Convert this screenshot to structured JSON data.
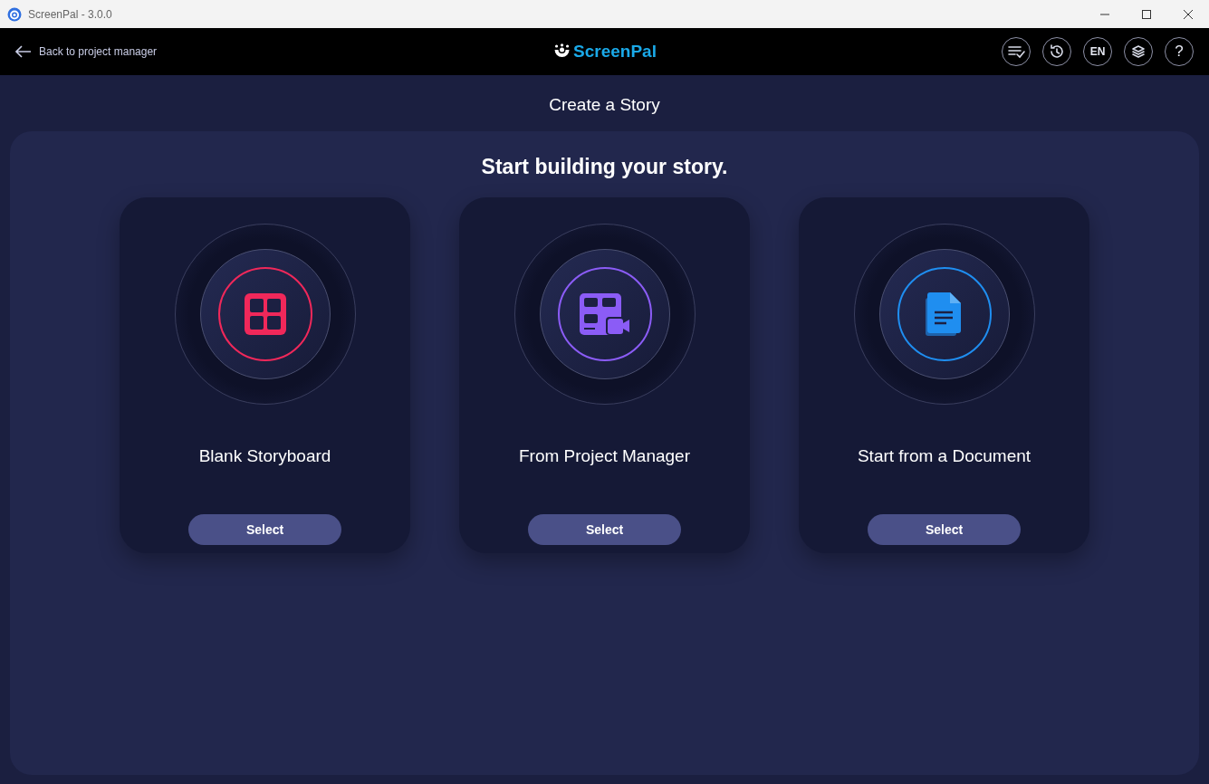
{
  "window": {
    "title": "ScreenPal - 3.0.0"
  },
  "header": {
    "back_link": "Back to project manager",
    "logo": "ScreenPal",
    "toolbar": [
      {
        "kind": "checklist"
      },
      {
        "kind": "history"
      },
      {
        "kind": "language",
        "label": "EN"
      },
      {
        "kind": "layers"
      },
      {
        "kind": "help",
        "label": "?"
      }
    ]
  },
  "page_title": "Create a Story",
  "heading": "Start building your story.",
  "cards": [
    {
      "kind": "grid",
      "title": "Blank Storyboard",
      "button": "Select",
      "color": "#f0285a"
    },
    {
      "kind": "storyboard-video",
      "title": "From Project Manager",
      "button": "Select",
      "color": "#8b5cf6"
    },
    {
      "kind": "document",
      "title": "Start from a Document",
      "button": "Select",
      "color": "#1f8ef0"
    }
  ]
}
